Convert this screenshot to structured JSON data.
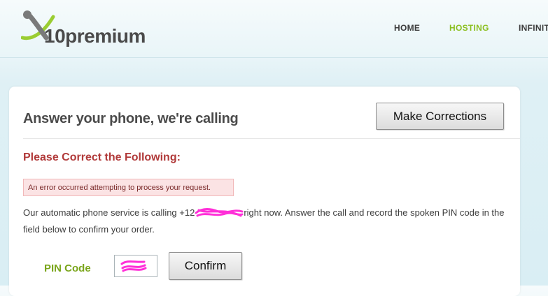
{
  "logo": {
    "brand_number": "10",
    "brand_word": "premium"
  },
  "nav": {
    "home": "HOME",
    "hosting": "HOSTING",
    "infinite": "INFINIT"
  },
  "colors": {
    "accent_green": "#8bbf1f",
    "error_red": "#b13a3a",
    "error_bg": "#fbe3e4"
  },
  "panel": {
    "title": "Answer your phone, we're calling",
    "make_corrections_label": "Make Corrections",
    "error_heading": "Please Correct the Following:",
    "error_message": "An error occurred attempting to process your request.",
    "message_before": "Our automatic phone service is calling +12",
    "message_after": "right now. Answer the call and record the spoken PIN code in the field below to confirm your order.",
    "pin_label": "PIN Code",
    "confirm_label": "Confirm"
  }
}
